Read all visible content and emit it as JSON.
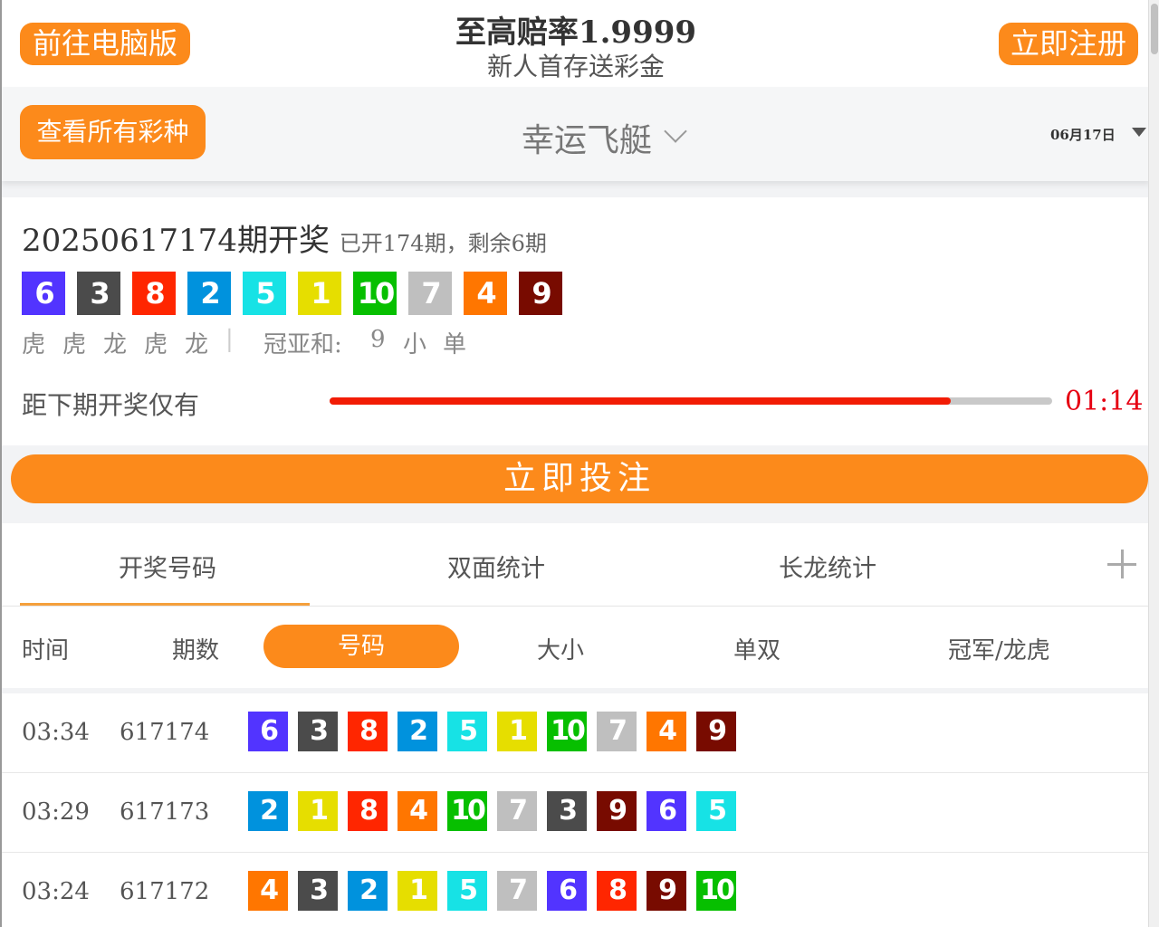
{
  "header": {
    "pc_button": "前往电脑版",
    "headline": "至高赔率1.9999",
    "subline": "新人首存送彩金",
    "register_button": "立即注册"
  },
  "lottery_bar": {
    "all_button": "查看所有彩种",
    "lottery_name": "幸运飞艇",
    "date": "06月17日"
  },
  "draw": {
    "issue_title": "20250617174期开奖",
    "issue_meta": "已开174期，剩余6期",
    "balls": [
      6,
      3,
      8,
      2,
      5,
      1,
      10,
      7,
      4,
      9
    ],
    "dragon_tiger": [
      "虎",
      "虎",
      "龙",
      "虎",
      "龙"
    ],
    "divider": "|",
    "sum_label": "冠亚和:",
    "sum_value": "9",
    "size": "小",
    "parity": "单",
    "countdown_label": "距下期开奖仅有",
    "progress_fraction": 0.86,
    "timer": "01:14"
  },
  "bet_button": "立即投注",
  "tabs": {
    "items": [
      "开奖号码",
      "双面统计",
      "长龙统计"
    ],
    "active_index": 0
  },
  "filters": {
    "time": "时间",
    "issue": "期数",
    "number": "号码",
    "size": "大小",
    "parity": "单双",
    "champion": "冠军/龙虎"
  },
  "ball_colors": {
    "1": "#e6de00",
    "2": "#0092dd",
    "3": "#4b4b4b",
    "4": "#ff7600",
    "5": "#17e2e5",
    "6": "#5234ff",
    "7": "#bfbfbf",
    "8": "#ff2600",
    "9": "#780b00",
    "10": "#07bf00"
  },
  "rows": [
    {
      "time": "03:34",
      "issue": "617174",
      "balls": [
        6,
        3,
        8,
        2,
        5,
        1,
        10,
        7,
        4,
        9
      ]
    },
    {
      "time": "03:29",
      "issue": "617173",
      "balls": [
        2,
        1,
        8,
        4,
        10,
        7,
        3,
        9,
        6,
        5
      ]
    },
    {
      "time": "03:24",
      "issue": "617172",
      "balls": [
        4,
        3,
        2,
        1,
        5,
        7,
        6,
        8,
        9,
        10
      ]
    }
  ]
}
